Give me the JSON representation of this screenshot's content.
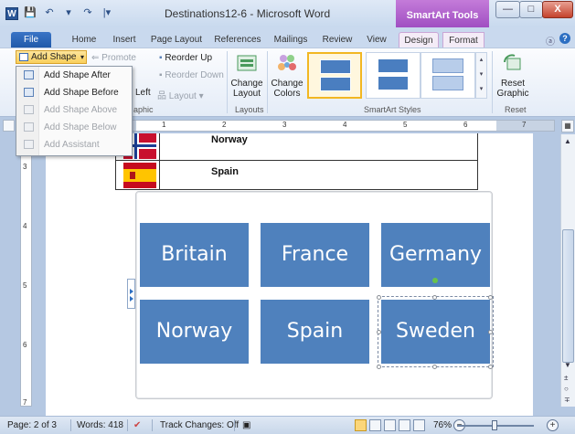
{
  "window": {
    "title": "Destinations12-6 - Microsoft Word",
    "context_tab_group": "SmartArt Tools",
    "logo_letter": "W",
    "qat": [
      "💾",
      "↶",
      "▾",
      "↷",
      "|▾"
    ],
    "buttons": {
      "minimize": "—",
      "maximize": "□",
      "close": "X"
    }
  },
  "tabs": [
    "File",
    "Home",
    "Insert",
    "Page Layout",
    "References",
    "Mailings",
    "Review",
    "View",
    "Design",
    "Format"
  ],
  "ribbon": {
    "add_shape": "Add Shape",
    "promote": "Promote",
    "reorder_up": "Reorder Up",
    "reorder_down": "Reorder Down",
    "left": "Left",
    "layout": "Layout",
    "graphic_group": "aphic",
    "change_layout": "Change Layout",
    "layouts_group": "Layouts",
    "change_colors": "Change Colors",
    "styles_group": "SmartArt Styles",
    "reset_graphic": "Reset Graphic",
    "reset_group": "Reset"
  },
  "dropdown": {
    "items": [
      {
        "label": "Add Shape After",
        "enabled": true
      },
      {
        "label": "Add Shape Before",
        "enabled": true
      },
      {
        "label": "Add Shape Above",
        "enabled": false
      },
      {
        "label": "Add Shape Below",
        "enabled": false
      },
      {
        "label": "Add Assistant",
        "enabled": false
      }
    ]
  },
  "ruler": {
    "h_numbers": [
      "1",
      "2",
      "3",
      "4",
      "5",
      "6",
      "7"
    ],
    "v_numbers": [
      "3",
      "4",
      "5",
      "6",
      "7"
    ]
  },
  "table": {
    "rows": [
      {
        "country": "Norway"
      },
      {
        "country": "Spain"
      }
    ]
  },
  "smartart": {
    "boxes": [
      "Britain",
      "France",
      "Germany",
      "Norway",
      "Spain",
      "Sweden"
    ],
    "selected": "Sweden",
    "color": "#4f81bd"
  },
  "status": {
    "page": "Page: 2 of 3",
    "words": "Words: 418",
    "track_changes": "Track Changes: Off",
    "zoom": "76%"
  }
}
